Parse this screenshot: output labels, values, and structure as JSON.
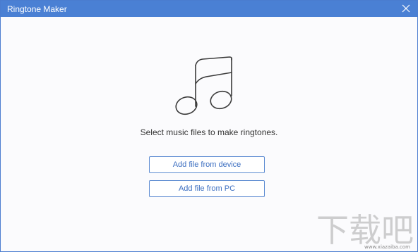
{
  "window": {
    "title": "Ringtone Maker"
  },
  "main": {
    "prompt": "Select music files to make ringtones.",
    "add_device_label": "Add file from device",
    "add_pc_label": "Add file from PC"
  },
  "watermark": {
    "text": "下载吧",
    "url": "www.xiazaiba.com"
  },
  "icons": {
    "close": "close-icon",
    "note": "music-note-icon"
  },
  "colors": {
    "titlebar": "#4a80d4",
    "button_border": "#5b8ad1",
    "button_text": "#3d6fc1"
  }
}
